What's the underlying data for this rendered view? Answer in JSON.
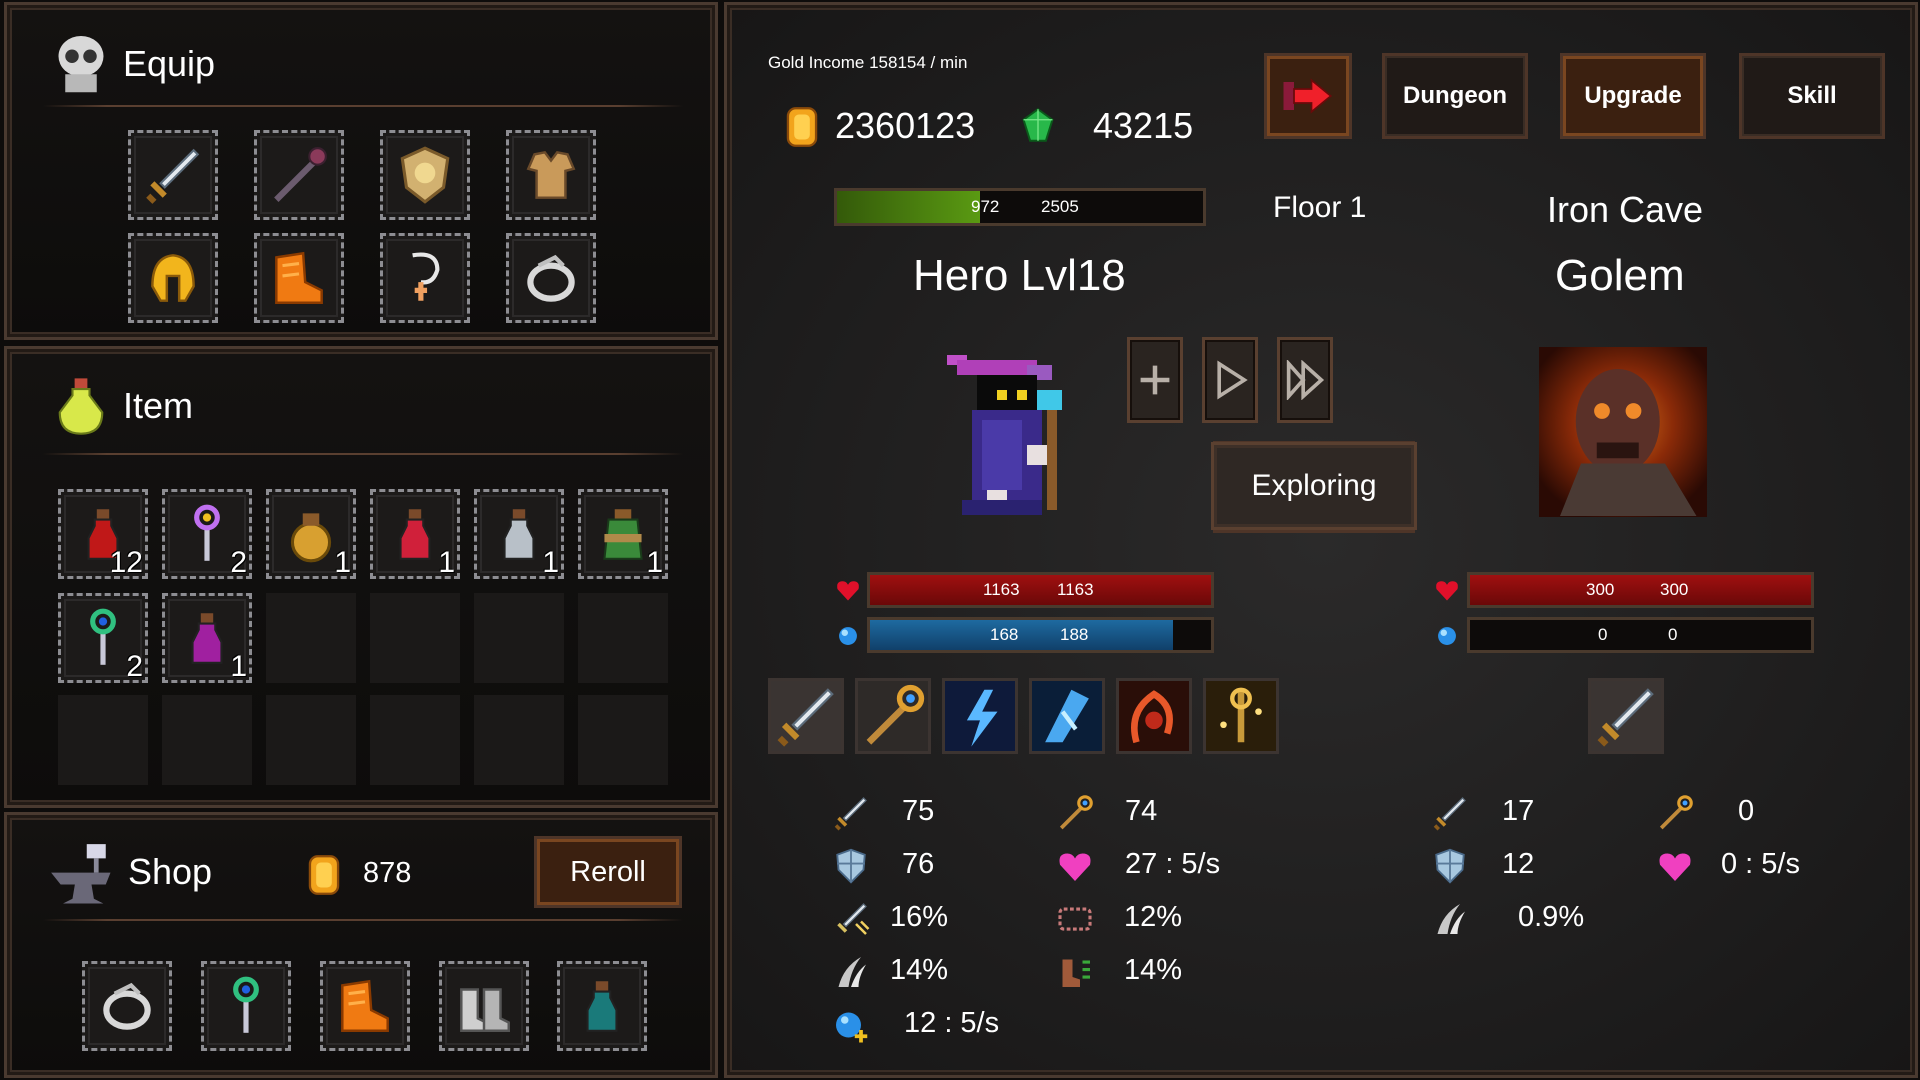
{
  "equip": {
    "title": "Equip",
    "slots": [
      "sword-icon",
      "staff-icon",
      "shield-icon",
      "armor-icon",
      "helmet-icon",
      "boots-icon",
      "amulet-icon",
      "ring-icon"
    ]
  },
  "item": {
    "title": "Item",
    "items": [
      {
        "icon": "red-potion-icon",
        "count": "12"
      },
      {
        "icon": "purple-wand-icon",
        "count": "2"
      },
      {
        "icon": "gold-bag-icon",
        "count": "1"
      },
      {
        "icon": "red-flask-icon",
        "count": "1"
      },
      {
        "icon": "gray-vial-icon",
        "count": "1"
      },
      {
        "icon": "green-jar-icon",
        "count": "1"
      },
      {
        "icon": "green-wand-icon",
        "count": "2"
      },
      {
        "icon": "purple-potion-icon",
        "count": "1"
      }
    ]
  },
  "shop": {
    "title": "Shop",
    "gold": "878",
    "reroll_label": "Reroll",
    "items": [
      "ring-icon",
      "green-wand-icon",
      "boots-icon",
      "iron-boots-icon",
      "teal-vial-icon"
    ]
  },
  "top": {
    "gold_income": "Gold Income 158154 / min",
    "gold": "2360123",
    "gems": "43215",
    "dungeon_label": "Dungeon",
    "upgrade_label": "Upgrade",
    "skill_label": "Skill"
  },
  "progress": {
    "current": "972",
    "max": "2505",
    "fraction": 0.39
  },
  "floor": "Floor 1",
  "location": "Iron Cave",
  "hero": {
    "name": "Hero Lvl18",
    "hp": "1163",
    "hp_max": "1163",
    "hp_fraction": 1.0,
    "mp": "168",
    "mp_max": "188",
    "mp_fraction": 0.89,
    "skills": [
      "sword-skill-icon",
      "staff-skill-icon",
      "lightning-skill-icon",
      "ice-skill-icon",
      "fire-skill-icon",
      "holy-skill-icon"
    ],
    "stats": {
      "attack": "75",
      "magic": "74",
      "defense": "76",
      "regen": "27 : 5/s",
      "crit": "16%",
      "lifesteal": "12%",
      "dodge": "14%",
      "speed": "14%",
      "mana_regen": "12 : 5/s"
    }
  },
  "enemy": {
    "name": "Golem",
    "hp": "300",
    "hp_max": "300",
    "hp_fraction": 1.0,
    "mp": "0",
    "mp_max": "0",
    "mp_fraction": 0.0,
    "skills": [
      "sword-skill-icon"
    ],
    "stats": {
      "attack": "17",
      "magic": "0",
      "defense": "12",
      "regen": "0 : 5/s",
      "dodge": "0.9%"
    }
  },
  "status": "Exploring",
  "colors": {
    "hp": "#8a0d0d",
    "mp": "#1a5c8e",
    "progress": "#4c7d12",
    "accent": "#7a4620"
  }
}
